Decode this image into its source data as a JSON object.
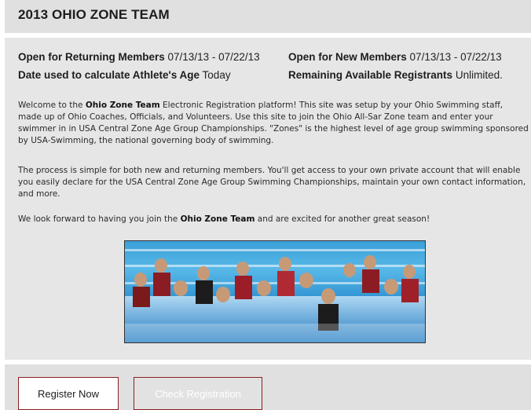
{
  "header": {
    "title": "2013 OHIO ZONE TEAM"
  },
  "info": {
    "returning_label": "Open for Returning Members",
    "returning_value": "07/13/13 - 07/22/13",
    "new_label": "Open for New Members",
    "new_value": "07/13/13 - 07/22/13",
    "age_label": "Date used to calculate Athlete's Age",
    "age_value": "Today",
    "remaining_label": "Remaining Available Registrants",
    "remaining_value": "Unlimited."
  },
  "body": {
    "p1_a": "Welcome to the ",
    "p1_b": "Ohio Zone Team",
    "p1_c": " Electronic Registration platform!   This site was setup by your Ohio Swimming staff, made up of Ohio Coaches, Officials, and Volunteers.  Use this site to join the Ohio All-Sar Zone team and enter your swimmer in in USA Central Zone Age Group Championships.  \"Zones\" is the highest level of age group swimming sponsored by USA-Swimming, the national governing body of swimming.",
    "p2": "The process is simple for both new and returning members. You'll get access to your own private account that will enable you easily declare for the USA Central Zone Age Group Swimming Championships, maintain your own contact information, and more.",
    "p3_a": "We look forward to having you join the ",
    "p3_b": "Ohio Zone Team",
    "p3_c": " and are excited for another great season!"
  },
  "buttons": {
    "register": "Register Now",
    "check": "Check Registration"
  }
}
